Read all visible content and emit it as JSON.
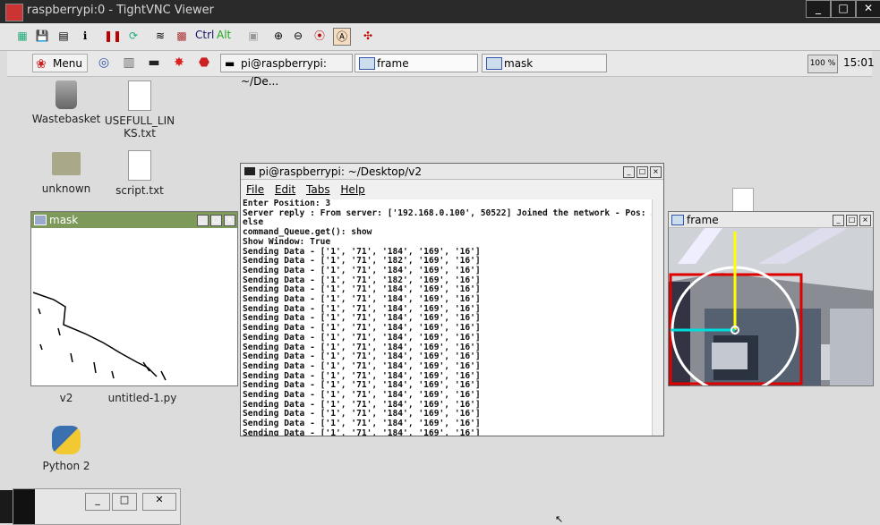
{
  "vnc": {
    "title": "raspberrypi:0 - TightVNC Viewer",
    "window_buttons": [
      "_",
      "□",
      "✕"
    ],
    "toolbar_text": [
      "Ctrl",
      "Alt"
    ]
  },
  "taskbar": {
    "menu_label": "Menu",
    "tasks": [
      "pi@raspberrypi: ~/De...",
      "frame",
      "mask"
    ],
    "cpu": "100 %",
    "clock": "15:01"
  },
  "desktop": {
    "icons": [
      "Wastebasket",
      "USEFULL_LIN\nKS.txt",
      "unknown",
      "script.txt",
      "v2",
      "untitled-1.py",
      "Python 2"
    ]
  },
  "mask_window": {
    "title": "mask"
  },
  "frame_window": {
    "title": "frame"
  },
  "terminal": {
    "title": "pi@raspberrypi: ~/Desktop/v2",
    "menu": [
      "File",
      "Edit",
      "Tabs",
      "Help"
    ],
    "lines": [
      "Enter Position: 3",
      "Server reply : From server: ['192.168.0.100', 50522] Joined the network - Pos: 3",
      "else",
      "command_Queue.get(): show",
      "Show Window: True",
      "Sending Data - ['1', '71', '184', '169', '16']",
      "Sending Data - ['1', '71', '182', '169', '16']",
      "Sending Data - ['1', '71', '184', '169', '16']",
      "Sending Data - ['1', '71', '182', '169', '16']",
      "Sending Data - ['1', '71', '184', '169', '16']",
      "Sending Data - ['1', '71', '184', '169', '16']",
      "Sending Data - ['1', '71', '184', '169', '16']",
      "Sending Data - ['1', '71', '184', '169', '16']",
      "Sending Data - ['1', '71', '184', '169', '16']",
      "Sending Data - ['1', '71', '184', '169', '16']",
      "Sending Data - ['1', '71', '184', '169', '16']",
      "Sending Data - ['1', '71', '184', '169', '16']",
      "Sending Data - ['1', '71', '184', '169', '16']",
      "Sending Data - ['1', '71', '184', '169', '16']",
      "Sending Data - ['1', '71', '184', '169', '16']",
      "Sending Data - ['1', '71', '184', '169', '16']",
      "Sending Data - ['1', '71', '184', '169', '16']",
      "Sending Data - ['1', '71', '184', '169', '16']",
      "Sending Data - ['1', '71', '184', '169', '16']",
      "Sending Data - ['1', '71', '184', '169', '16']"
    ]
  },
  "bottom_window": {
    "buttons": [
      "_",
      "□",
      "✕"
    ]
  },
  "colors": {
    "titlebar_active": "#7e9a5a",
    "terminal_title": "#e8e8e8"
  }
}
